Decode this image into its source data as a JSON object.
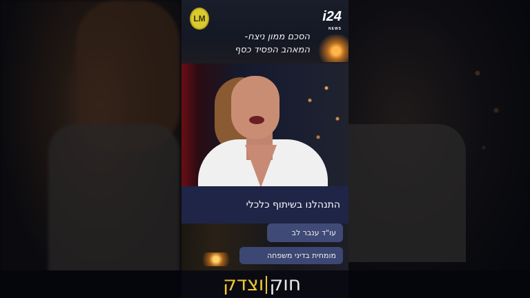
{
  "logos": {
    "left_logo_text": "LM",
    "network_logo_text": "i24",
    "network_logo_subtext": "NEWS"
  },
  "headline": {
    "line1": "הסכם ממון ניצח-",
    "line2": "המאהב הפסיד כסף"
  },
  "caption": {
    "text": "התנהלנו בשיתוף כלכלי"
  },
  "speaker": {
    "name": "עו\"ד ענבר לב",
    "title": "מומחית בדיני משפחה"
  },
  "show": {
    "word_right": "חוק",
    "word_left": "וצדק"
  },
  "colors": {
    "caption_bar": "#1f2547",
    "name_pill": "#3f4a76",
    "show_accent": "#f3c531"
  }
}
